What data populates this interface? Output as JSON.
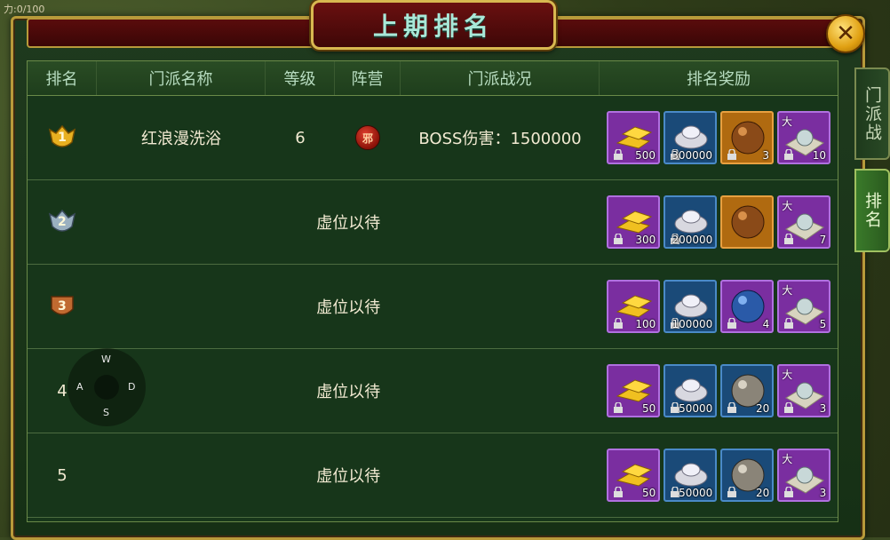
{
  "hud": {
    "top_left_text": "力:0/100"
  },
  "panel": {
    "title": "上期排名",
    "close_icon": "close-icon"
  },
  "table": {
    "headers": [
      "排名",
      "门派名称",
      "等级",
      "阵营",
      "门派战况",
      "排名奖励"
    ]
  },
  "rows": [
    {
      "rank": "1",
      "guild_name": "红浪漫洗浴",
      "level": "6",
      "camp_icon": "邪",
      "status": "BOSS伤害：1500000",
      "empty": "",
      "rewards": [
        {
          "icon": "gold-bar-icon",
          "qty": "500",
          "tag": ""
        },
        {
          "icon": "silver-ingot-icon",
          "qty": "300000",
          "tag": ""
        },
        {
          "icon": "bronze-ball-icon",
          "qty": "3",
          "tag": ""
        },
        {
          "icon": "big-pearl-scroll-icon",
          "qty": "10",
          "tag": "大"
        }
      ]
    },
    {
      "rank": "2",
      "guild_name": "",
      "level": "",
      "camp_icon": "",
      "status": "",
      "empty": "虚位以待",
      "rewards": [
        {
          "icon": "gold-bar-icon",
          "qty": "300",
          "tag": ""
        },
        {
          "icon": "silver-ingot-icon",
          "qty": "200000",
          "tag": ""
        },
        {
          "icon": "bronze-ball-icon",
          "qty": "",
          "tag": ""
        },
        {
          "icon": "big-pearl-scroll-icon",
          "qty": "7",
          "tag": "大"
        }
      ]
    },
    {
      "rank": "3",
      "guild_name": "",
      "level": "",
      "camp_icon": "",
      "status": "",
      "empty": "虚位以待",
      "rewards": [
        {
          "icon": "gold-bar-icon",
          "qty": "100",
          "tag": ""
        },
        {
          "icon": "silver-ingot-icon",
          "qty": "100000",
          "tag": ""
        },
        {
          "icon": "blue-ball-icon",
          "qty": "4",
          "tag": ""
        },
        {
          "icon": "big-pearl-scroll-icon",
          "qty": "5",
          "tag": "大"
        }
      ]
    },
    {
      "rank": "4",
      "guild_name": "",
      "level": "",
      "camp_icon": "",
      "status": "",
      "empty": "虚位以待",
      "rewards": [
        {
          "icon": "gold-bar-icon",
          "qty": "50",
          "tag": ""
        },
        {
          "icon": "silver-ingot-icon",
          "qty": "50000",
          "tag": ""
        },
        {
          "icon": "grey-ball-icon",
          "qty": "20",
          "tag": ""
        },
        {
          "icon": "big-pearl-scroll-icon",
          "qty": "3",
          "tag": "大"
        }
      ]
    },
    {
      "rank": "5",
      "guild_name": "",
      "level": "",
      "camp_icon": "",
      "status": "",
      "empty": "虚位以待",
      "rewards": [
        {
          "icon": "gold-bar-icon",
          "qty": "50",
          "tag": ""
        },
        {
          "icon": "silver-ingot-icon",
          "qty": "50000",
          "tag": ""
        },
        {
          "icon": "grey-ball-icon",
          "qty": "20",
          "tag": ""
        },
        {
          "icon": "big-pearl-scroll-icon",
          "qty": "3",
          "tag": "大"
        }
      ]
    }
  ],
  "compass": {
    "n": "W",
    "w": "A",
    "e": "D",
    "s": "S"
  },
  "side_tabs": [
    {
      "label": "门派战",
      "active": false
    },
    {
      "label": "排名",
      "active": true
    }
  ],
  "colors": {
    "panel_bg": "#17361a",
    "frame_gold": "#b89a3a",
    "title_text": "#a8e8d8",
    "header_text": "#b7dcc0"
  }
}
